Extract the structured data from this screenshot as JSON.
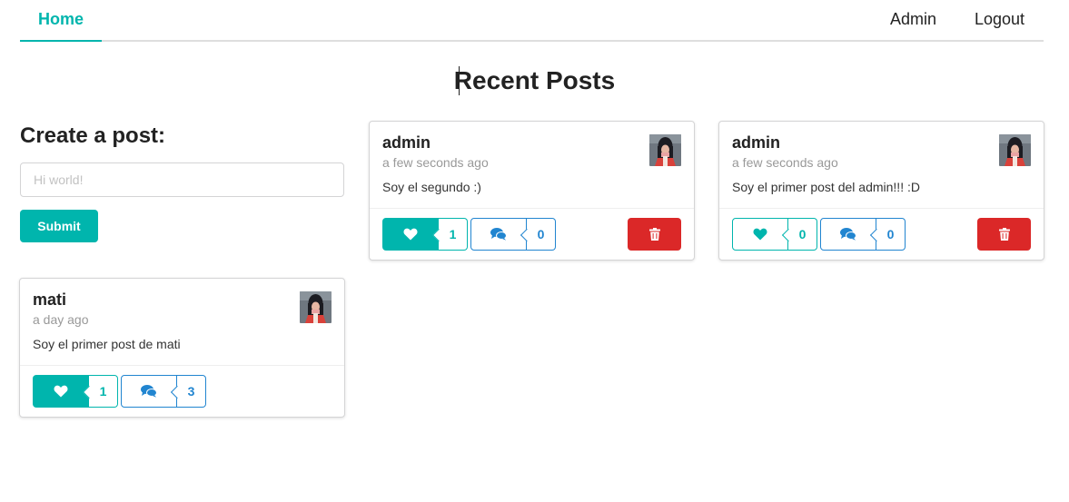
{
  "nav": {
    "home": "Home",
    "admin": "Admin",
    "logout": "Logout"
  },
  "page_title": "Recent Posts",
  "form": {
    "title": "Create a post:",
    "placeholder": "Hi world!",
    "value": "",
    "submit_label": "Submit"
  },
  "colors": {
    "teal": "#00b5ad",
    "blue": "#2185d0",
    "red": "#db2828"
  },
  "posts": [
    {
      "author": "admin",
      "time": "a few seconds ago",
      "text": "Soy el segundo :)",
      "likes": "1",
      "liked": true,
      "comments": "0",
      "deletable": true,
      "icons": [
        "heart-icon",
        "comments-icon",
        "trash-icon"
      ]
    },
    {
      "author": "admin",
      "time": "a few seconds ago",
      "text": "Soy el primer post del admin!!! :D",
      "likes": "0",
      "liked": false,
      "comments": "0",
      "deletable": true,
      "icons": [
        "heart-icon",
        "comments-icon",
        "trash-icon"
      ]
    },
    {
      "author": "mati",
      "time": "a day ago",
      "text": "Soy el primer post de mati",
      "likes": "1",
      "liked": true,
      "comments": "3",
      "deletable": false,
      "icons": [
        "heart-icon",
        "comments-icon"
      ]
    }
  ]
}
